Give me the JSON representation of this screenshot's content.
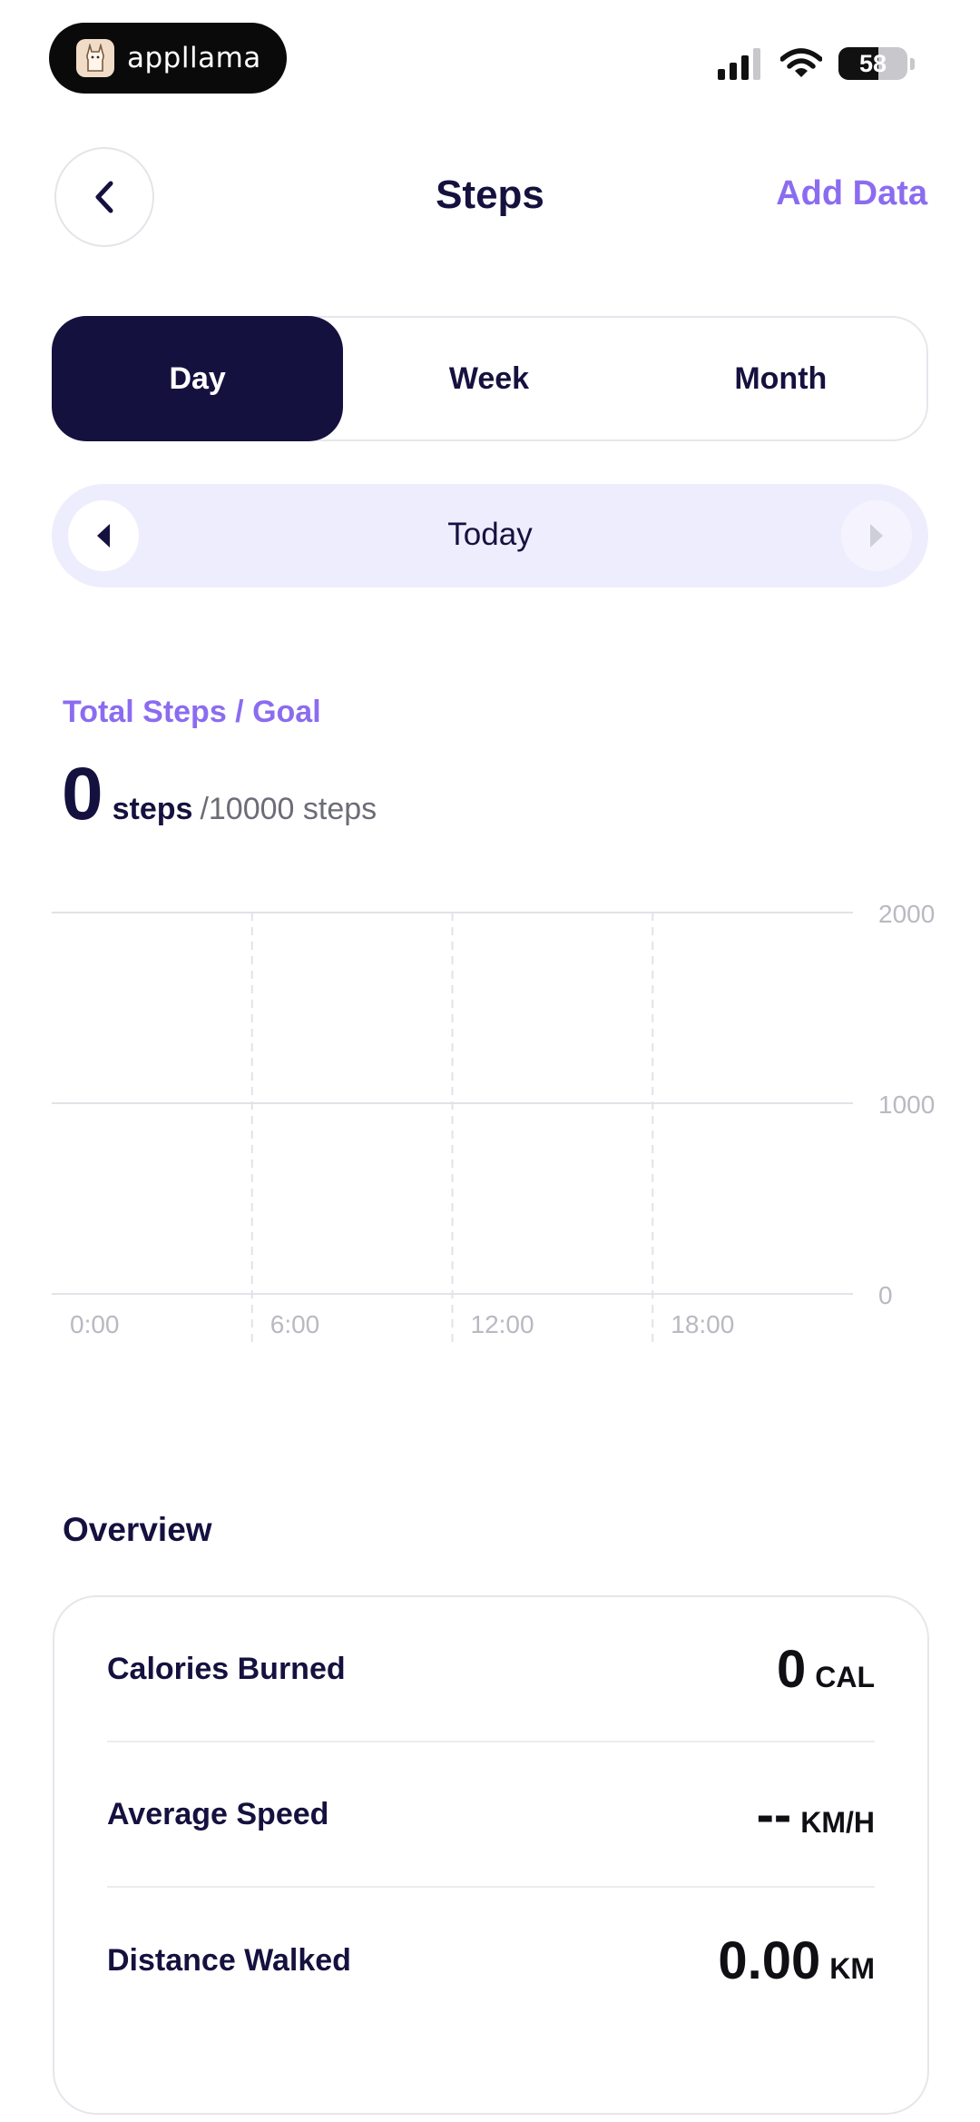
{
  "status_bar": {
    "brand_name": "appllama",
    "battery_percent": "58",
    "battery_level": 0.58
  },
  "header": {
    "title": "Steps",
    "add_data_label": "Add Data"
  },
  "segments": {
    "items": [
      {
        "label": "Day",
        "active": true
      },
      {
        "label": "Week",
        "active": false
      },
      {
        "label": "Month",
        "active": false
      }
    ]
  },
  "date_nav": {
    "label": "Today"
  },
  "totals": {
    "label": "Total Steps / Goal",
    "value": "0",
    "unit": "steps",
    "goal": "/10000 steps"
  },
  "chart_data": {
    "type": "bar",
    "x_ticks": [
      "0:00",
      "6:00",
      "12:00",
      "18:00"
    ],
    "y_ticks": [
      0,
      1000,
      2000
    ],
    "ylim": [
      0,
      2000
    ],
    "values": [],
    "grid": true
  },
  "overview": {
    "title": "Overview",
    "rows": [
      {
        "label": "Calories Burned",
        "value": "0",
        "unit": "CAL"
      },
      {
        "label": "Average Speed",
        "value": "--",
        "unit": "KM/H"
      },
      {
        "label": "Distance Walked",
        "value": "0.00",
        "unit": "KM"
      }
    ]
  },
  "colors": {
    "navy": "#15113f",
    "accent": "#8b6cf0",
    "date_nav_bg": "#eeedfd"
  }
}
